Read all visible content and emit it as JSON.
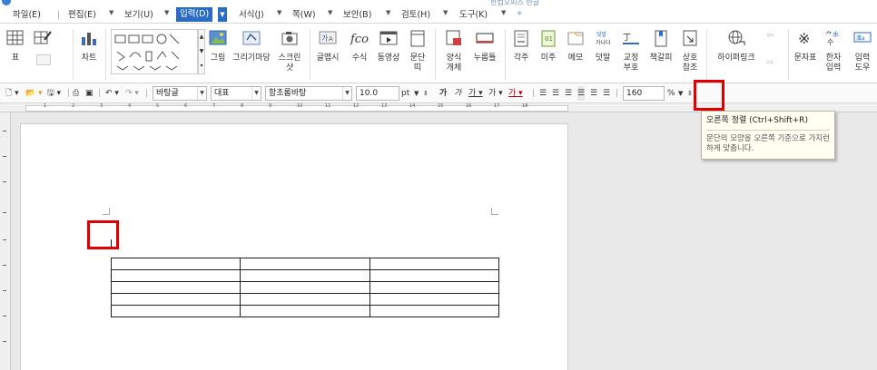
{
  "top": {
    "caption": "한컴오피스 한글"
  },
  "menu": {
    "items": [
      "파일(E)",
      "편집(E)",
      "보기(U)",
      "입력(D)",
      "서식(J)",
      "쪽(W)",
      "보안(B)",
      "검토(H)",
      "도구(K)"
    ],
    "active": "입력(D)"
  },
  "ribbon": {
    "table": "표",
    "chart": "차트",
    "picture": "그림",
    "drawing": "그리기마당",
    "screenshot": "스크린\n샷",
    "glyph": "글맵시",
    "formula": "수식",
    "video": "동영상",
    "paragraph": "문단\n띠",
    "form": "양식\n개체",
    "button": "누름틀",
    "footnote": "각주",
    "endnote": "미주",
    "memo": "메모",
    "annotation": "덧말",
    "proof": "교정\n부호",
    "bookmark": "책갈피",
    "crossref": "상호\n참조",
    "hyperlink": "하이퍼링크",
    "symbol": "문자표",
    "hanja": "한자\n입력",
    "input_help": "입력\n도우"
  },
  "format": {
    "style": "바탕글",
    "outline": "대표",
    "font": "함초롬바탕",
    "size": "10.0",
    "size_unit": "pt",
    "line_spacing": "160",
    "line_unit": "%"
  },
  "ruler_numbers": [
    "1",
    "2",
    "3",
    "4",
    "5",
    "6",
    "7",
    "8",
    "9",
    "10",
    "11",
    "12",
    "13",
    "14",
    "15",
    "16",
    "17",
    "18"
  ],
  "tooltip": {
    "title": "오른쪽 정렬 (Ctrl+Shift+R)",
    "description": "문단의 모양을 오른쪽 기준으로 가지런하게 맞춥니다."
  }
}
